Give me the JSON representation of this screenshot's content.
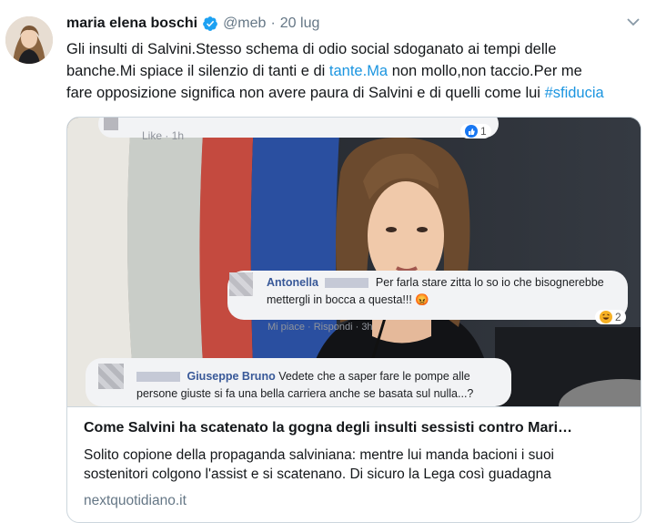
{
  "tweet": {
    "author_name": "maria elena boschi",
    "handle": "@meb",
    "separator": "·",
    "date": "20 lug",
    "text_line1": "Gli insulti di Salvini.Stesso schema di odio social sdoganato ai tempi delle",
    "text_line2": "banche.Mi spiace il silenzio di tanti e di ",
    "text_link1": "tante.Ma",
    "text_line2_end": " non mollo,non taccio.Per me",
    "text_line3": "fare opposizione significa non avere paura di Salvini e di quelli come lui ",
    "text_hashtag": "#sfiducia"
  },
  "card": {
    "title": "Come Salvini ha scatenato la gogna degli insulti sessisti contro Mari…",
    "desc_line1": "Solito copione della propaganda salviniana: mentre lui manda bacioni i suoi",
    "desc_line2": "sostenitori colgono l'assist e si scatenano. Di sicuro la Lega così guadagna",
    "domain": "nextquotidiano.it",
    "comments": {
      "top_meta": "Like · 1h",
      "top_reaction_count": "1",
      "c1_name": "Antonella",
      "c1_line1": "Per farla stare zitta lo so io che bisognerebbe",
      "c1_line2": "mettergli in bocca a questa!!! 😡",
      "c1_reaction_count": "2",
      "c1_meta": "Mi piace · Rispondi · 3h",
      "c2_name": "Giuseppe Bruno",
      "c2_line1": "Vedete che a saper fare le pompe alle",
      "c2_line2": "persone giuste si fa una bella carriera anche se basata sul nulla...?"
    }
  },
  "colors": {
    "link": "#1b95e0",
    "secondary_text": "#657786",
    "border": "#ccd6dd",
    "verified": "#1da1f2",
    "fb_name": "#385898"
  },
  "icons": [
    "verified-badge-icon",
    "chevron-down-icon",
    "like-reaction-icon",
    "angry-emoji-icon",
    "laughing-reaction-icon"
  ]
}
